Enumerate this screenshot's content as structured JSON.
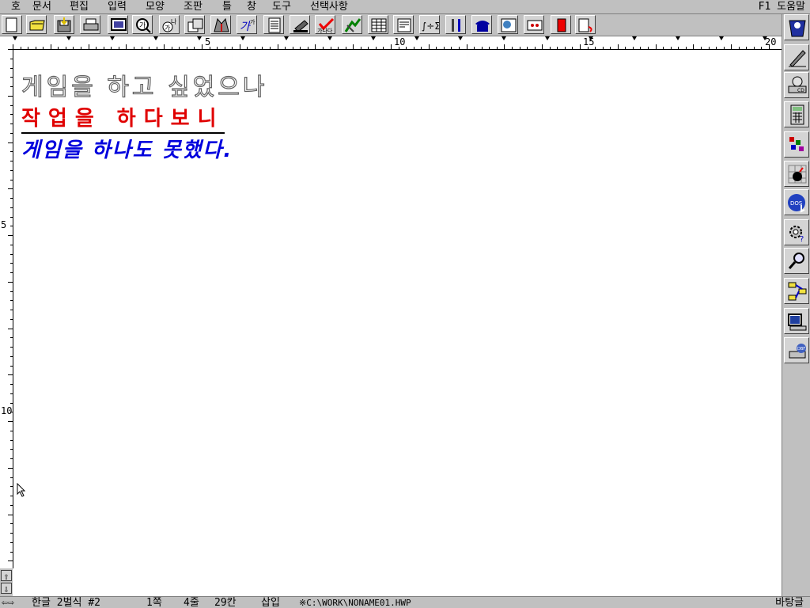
{
  "menubar": {
    "items": [
      "호",
      "문서",
      "편집",
      "입력",
      "모양",
      "조판",
      "틀",
      "창",
      "도구",
      "선택사항"
    ],
    "help": "F1 도움말"
  },
  "toolbar": {
    "buttons": [
      "new-document-icon",
      "open-folder-icon",
      "save-icon",
      "print-icon",
      "preview-icon",
      "find-icon",
      "replace-icon",
      "copy-format-icon",
      "paint-icon",
      "style-icon",
      "page-icon",
      "stamp-icon",
      "spell-check-icon",
      "draw-icon",
      "table-icon",
      "list-icon",
      "formula-icon",
      "tools-icon",
      "phone-icon",
      "dictionary-icon",
      "book-icon",
      "bookmark-icon",
      "attach-icon"
    ]
  },
  "ruler": {
    "labels": [
      "5",
      "10",
      "15",
      "20"
    ]
  },
  "vruler": {
    "labels": [
      "5",
      "10"
    ]
  },
  "document": {
    "line1": "게임을 하고 싶었으나",
    "line2": "작업을 하다보니",
    "line3": "게임을 하나도 못했다."
  },
  "sidepanel": {
    "buttons": [
      "app-logo-icon",
      "pen-icon",
      "cd-icon",
      "calculator-icon",
      "puzzle-icon",
      "bomb-game-icon",
      "dos-icon",
      "settings-help-icon",
      "search-tool-icon",
      "flowchart-icon",
      "computer-icon",
      "database-icon"
    ]
  },
  "statusbar": {
    "font": "한글 2벌식 #2",
    "page": "1쪽",
    "line": "4줄",
    "column": "29칸",
    "mode": "삽입",
    "file": "※C:\\WORK\\NONAME01.HWP",
    "background": "바탕글"
  },
  "colors": {
    "chrome": "#c0c0c0",
    "line2": "#e00000",
    "line3": "#0000dd"
  }
}
